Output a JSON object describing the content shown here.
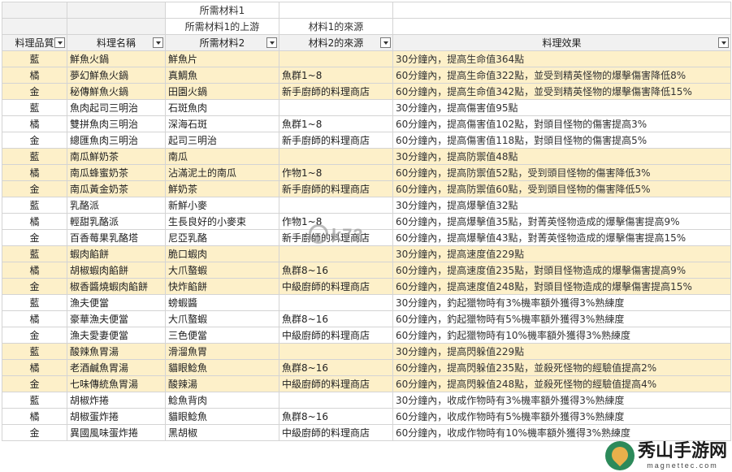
{
  "header": {
    "top1": [
      "",
      "",
      "所需材料1",
      "",
      ""
    ],
    "top2": [
      "",
      "",
      "所需材料1的上游",
      "材料1的來源",
      ""
    ],
    "columns": [
      "料理品質",
      "料理名稱",
      "所需材料2",
      "材料2的來源",
      "料理效果"
    ]
  },
  "rows": [
    {
      "q": "藍",
      "name": "鮮魚火鍋",
      "mat": "鮮魚片",
      "src": "",
      "eff": "30分鐘內，提高生命值364點",
      "hl": true
    },
    {
      "q": "橘",
      "name": "夢幻鮮魚火鍋",
      "mat": "真鯛魚",
      "src": "魚群1~8",
      "eff": "60分鐘內，提高生命值322點，並受到精英怪物的爆擊傷害降低8%",
      "hl": true
    },
    {
      "q": "金",
      "name": "秘傳鮮魚火鍋",
      "mat": "田園火鍋",
      "src": "新手廚師的料理商店",
      "eff": "60分鐘內，提高生命值342點，並受到精英怪物的爆擊傷害降低15%",
      "hl": true
    },
    {
      "q": "藍",
      "name": "魚肉起司三明治",
      "mat": "石斑魚肉",
      "src": "",
      "eff": "30分鐘內，提高傷害值95點",
      "hl": false
    },
    {
      "q": "橘",
      "name": "雙拼魚肉三明治",
      "mat": "深海石斑",
      "src": "魚群1~8",
      "eff": "60分鐘內，提高傷害值102點，對頭目怪物的傷害提高3%",
      "hl": false
    },
    {
      "q": "金",
      "name": "總匯魚肉三明治",
      "mat": "起司三明治",
      "src": "新手廚師的料理商店",
      "eff": "60分鐘內，提高傷害值118點，對頭目怪物的傷害提高5%",
      "hl": false
    },
    {
      "q": "藍",
      "name": "南瓜鮮奶茶",
      "mat": "南瓜",
      "src": "",
      "eff": "30分鐘內，提高防禦值48點",
      "hl": true
    },
    {
      "q": "橘",
      "name": "南瓜蜂蜜奶茶",
      "mat": "沾滿泥土的南瓜",
      "src": "作物1~8",
      "eff": "60分鐘內，提高防禦值52點，受到頭目怪物的傷害降低3%",
      "hl": true
    },
    {
      "q": "金",
      "name": "南瓜黃金奶茶",
      "mat": "鮮奶茶",
      "src": "新手廚師的料理商店",
      "eff": "60分鐘內，提高防禦值60點，受到頭目怪物的傷害降低5%",
      "hl": true
    },
    {
      "q": "藍",
      "name": "乳酪派",
      "mat": "新鮮小麥",
      "src": "",
      "eff": "30分鐘內，提高爆擊值32點",
      "hl": false
    },
    {
      "q": "橘",
      "name": "輕甜乳酪派",
      "mat": "生長良好的小麥束",
      "src": "作物1~8",
      "eff": "60分鐘內，提高爆擊值35點，對菁英怪物造成的爆擊傷害提高9%",
      "hl": false
    },
    {
      "q": "金",
      "name": "百香莓果乳酪塔",
      "mat": "尼亞乳酪",
      "src": "新手廚師的料理商店",
      "eff": "60分鐘內，提高爆擊值43點，對菁英怪物造成的爆擊傷害提高15%",
      "hl": false
    },
    {
      "q": "藍",
      "name": "蝦肉餡餅",
      "mat": "脆口蝦肉",
      "src": "",
      "eff": "30分鐘內，提高速度值229點",
      "hl": true
    },
    {
      "q": "橘",
      "name": "胡椒蝦肉餡餅",
      "mat": "大爪螯蝦",
      "src": "魚群8~16",
      "eff": "60分鐘內，提高速度值235點，對頭目怪物造成的爆擊傷害提高9%",
      "hl": true
    },
    {
      "q": "金",
      "name": "椒香醬燒蝦肉餡餅",
      "mat": "快炸餡餅",
      "src": "中級廚師的料理商店",
      "eff": "60分鐘內，提高速度值248點，對頭目怪物造成的爆擊傷害提高15%",
      "hl": true
    },
    {
      "q": "藍",
      "name": "漁夫便當",
      "mat": "螃蝦醬",
      "src": "",
      "eff": "30分鐘內，釣起獵物時有3%機率額外獲得3%熟練度",
      "hl": false
    },
    {
      "q": "橘",
      "name": "豪華漁夫便當",
      "mat": "大爪螯蝦",
      "src": "魚群8~16",
      "eff": "60分鐘內，釣起獵物時有5%機率額外獲得3%熟練度",
      "hl": false
    },
    {
      "q": "金",
      "name": "漁夫愛妻便當",
      "mat": "三色便當",
      "src": "中級廚師的料理商店",
      "eff": "60分鐘內，釣起獵物時有10%機率額外獲得3%熟練度",
      "hl": false
    },
    {
      "q": "藍",
      "name": "酸辣魚胃湯",
      "mat": "滑溜魚胃",
      "src": "",
      "eff": "30分鐘內，提高閃躲值229點",
      "hl": true
    },
    {
      "q": "橘",
      "name": "老酒鹹魚胃湯",
      "mat": "貓眼鯰魚",
      "src": "魚群8~16",
      "eff": "60分鐘內，提高閃躲值235點，並殺死怪物的經驗值提高2%",
      "hl": true
    },
    {
      "q": "金",
      "name": "七味傳統魚胃湯",
      "mat": "酸辣湯",
      "src": "中級廚師的料理商店",
      "eff": "60分鐘內，提高閃躲值248點，並殺死怪物的經驗值提高4%",
      "hl": true
    },
    {
      "q": "藍",
      "name": "胡椒炸捲",
      "mat": "鯰魚背肉",
      "src": "",
      "eff": "30分鐘內，收成作物時有3%機率額外獲得3%熟練度",
      "hl": false
    },
    {
      "q": "橘",
      "name": "胡椒蛋炸捲",
      "mat": "貓眼鯰魚",
      "src": "魚群8~16",
      "eff": "60分鐘內，收成作物時有5%機率額外獲得3%熟練度",
      "hl": false
    },
    {
      "q": "金",
      "name": "異國風味蛋炸捲",
      "mat": "黑胡椒",
      "src": "中級廚師的料理商店",
      "eff": "60分鐘內，收成作物時有10%機率額外獲得3%熟練度",
      "hl": false
    }
  ],
  "watermark": {
    "text": "k73"
  },
  "logo": {
    "name": "秀山手游网",
    "url": "magnettec.com"
  },
  "colors": {
    "highlight_row": "#fdf0c9",
    "header_bg": "#f1f1f1",
    "gridline": "#d4d4d4"
  }
}
